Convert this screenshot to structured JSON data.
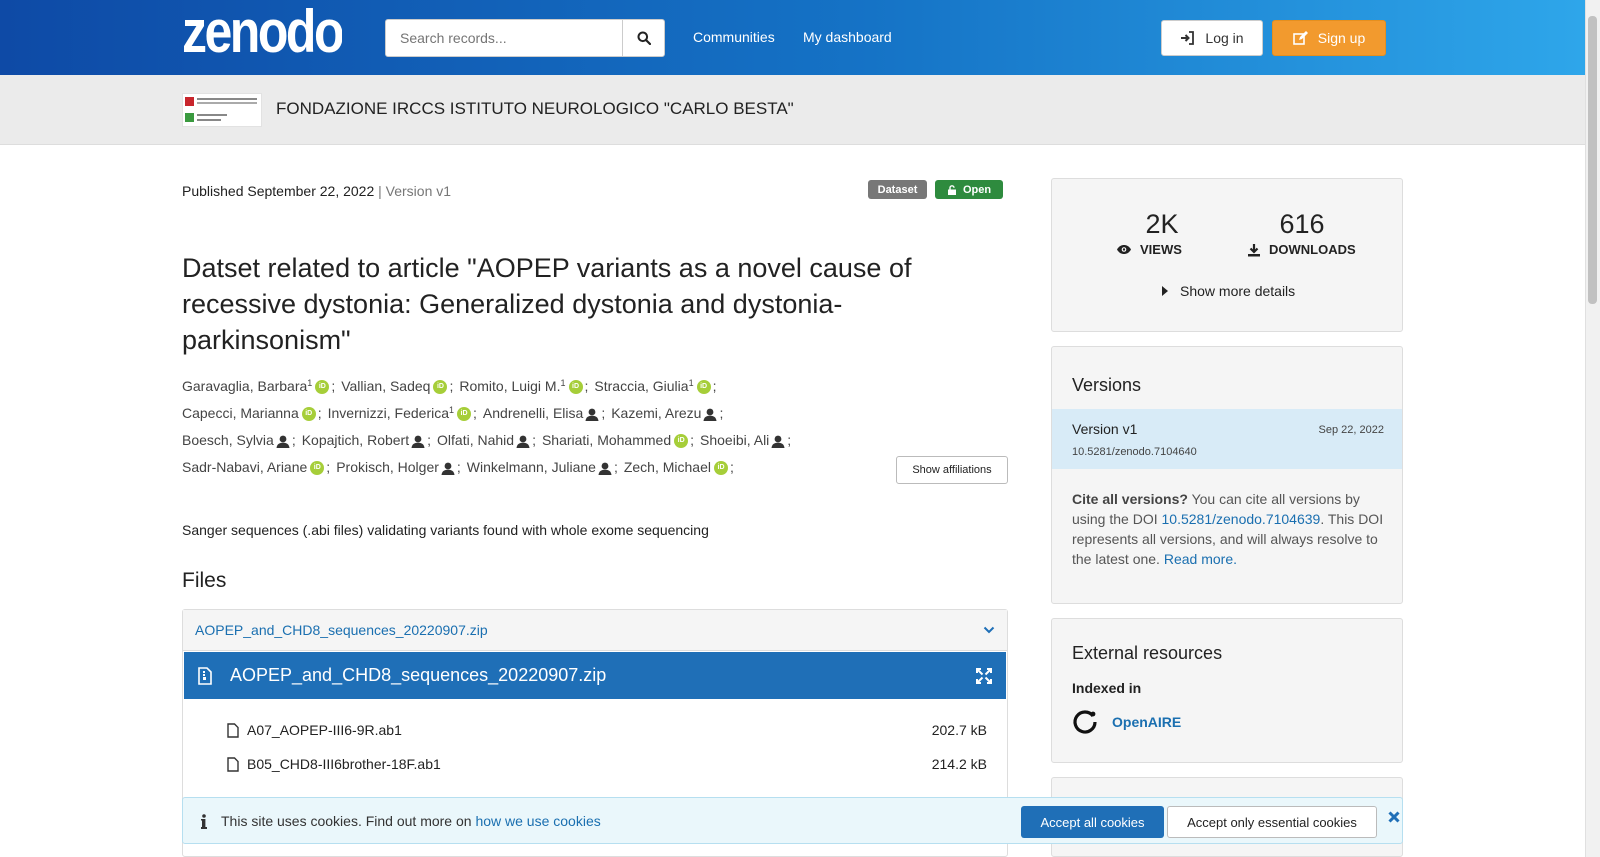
{
  "header": {
    "logo_text": "zenodo",
    "search_placeholder": "Search records...",
    "nav": [
      "Communities",
      "My dashboard"
    ],
    "login_label": "Log in",
    "signup_label": "Sign up"
  },
  "community": {
    "title": "FONDAZIONE IRCCS ISTITUTO NEUROLOGICO \"CARLO BESTA\""
  },
  "record": {
    "published_label": "Published September 22, 2022",
    "version_label": "| Version v1",
    "badge_type": "Dataset",
    "badge_access": "Open",
    "title": "Datset related to article \"AOPEP variants as a novel cause of recessive dystonia: Generalized dystonia and dystonia-parkinsonism\"",
    "authors": [
      {
        "name": "Garavaglia, Barbara",
        "sup": "1",
        "mark": "orcid"
      },
      {
        "name": "Vallian, Sadeq",
        "sup": "",
        "mark": "orcid"
      },
      {
        "name": "Romito, Luigi M.",
        "sup": "1",
        "mark": "orcid"
      },
      {
        "name": "Straccia, Giulia",
        "sup": "1",
        "mark": "orcid"
      },
      {
        "name": "Capecci, Marianna",
        "sup": "",
        "mark": "orcid"
      },
      {
        "name": "Invernizzi, Federica",
        "sup": "1",
        "mark": "orcid"
      },
      {
        "name": "Andrenelli, Elisa",
        "sup": "",
        "mark": "person"
      },
      {
        "name": "Kazemi, Arezu",
        "sup": "",
        "mark": "person"
      },
      {
        "name": "Boesch, Sylvia",
        "sup": "",
        "mark": "person"
      },
      {
        "name": "Kopajtich, Robert",
        "sup": "",
        "mark": "person"
      },
      {
        "name": "Olfati, Nahid",
        "sup": "",
        "mark": "person"
      },
      {
        "name": "Shariati, Mohammed",
        "sup": "",
        "mark": "orcid"
      },
      {
        "name": "Shoeibi, Ali",
        "sup": "",
        "mark": "person"
      },
      {
        "name": "Sadr-Nabavi, Ariane",
        "sup": "",
        "mark": "orcid"
      },
      {
        "name": "Prokisch, Holger",
        "sup": "",
        "mark": "person"
      },
      {
        "name": "Winkelmann, Juliane",
        "sup": "",
        "mark": "person"
      },
      {
        "name": "Zech, Michael",
        "sup": "",
        "mark": "orcid"
      }
    ],
    "orcid_glyph": "iD",
    "separator": ";",
    "show_affiliations_label": "Show affiliations",
    "description": "Sanger sequences (.abi files) validating variants found with whole exome sequencing"
  },
  "files": {
    "heading": "Files",
    "archive_name": "AOPEP_and_CHD8_sequences_20220907.zip",
    "entries": [
      {
        "name": "A07_AOPEP-III6-9R.ab1",
        "size": "202.7 kB"
      },
      {
        "name": "B05_CHD8-III6brother-18F.ab1",
        "size": "214.2 kB"
      }
    ]
  },
  "stats": {
    "views_count": "2K",
    "views_label": "VIEWS",
    "downloads_count": "616",
    "downloads_label": "DOWNLOADS",
    "show_more_label": "Show more details"
  },
  "versions": {
    "heading": "Versions",
    "current_label": "Version v1",
    "current_date": "Sep 22, 2022",
    "current_doi": "10.5281/zenodo.7104640",
    "cite_bold": "Cite all versions?",
    "cite_text_1": " You can cite all versions by using the DOI ",
    "cite_doi": "10.5281/zenodo.7104639",
    "cite_text_2": ". This DOI represents all versions, and will always resolve to the latest one. ",
    "read_more": "Read more."
  },
  "external": {
    "heading": "External resources",
    "indexed_in": "Indexed in",
    "openaire": "OpenAIRE"
  },
  "cookie": {
    "text": "This site uses cookies. Find out more on ",
    "link": "how we use cookies",
    "accept_all": "Accept all cookies",
    "accept_essential": "Accept only essential cookies"
  },
  "colors": {
    "header_start": "#0e4aa6",
    "header_end": "#2ea6ea",
    "signup": "#f29a2e",
    "dataset_badge": "#777777",
    "open_badge": "#2e8b3e",
    "orcid": "#a6ce39",
    "accent_blue": "#1f6fb7"
  }
}
